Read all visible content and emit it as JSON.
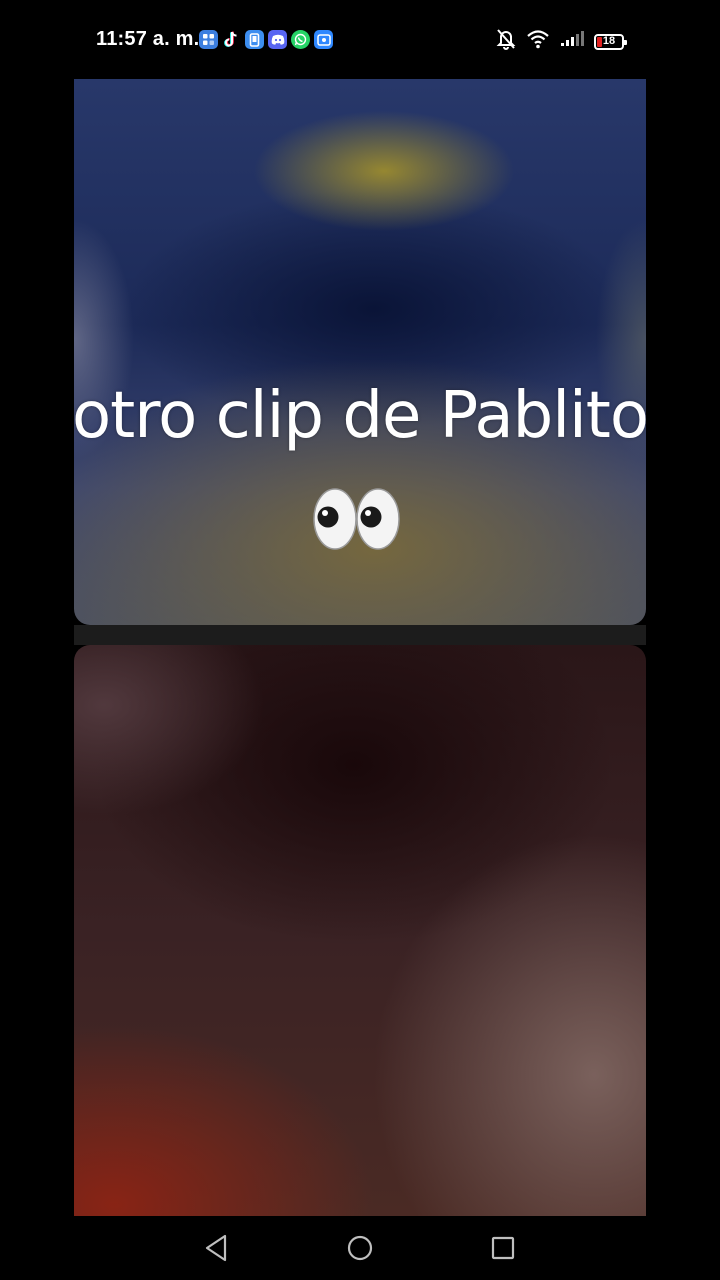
{
  "status_bar": {
    "time": "11:57 a. m.",
    "battery_level": "18",
    "notification_icons": [
      {
        "name": "app-store-icon",
        "color": "#3d7fe0"
      },
      {
        "name": "tiktok-icon",
        "color": "#111111"
      },
      {
        "name": "phone-manager-icon",
        "color": "#3d8ef0"
      },
      {
        "name": "discord-icon",
        "color": "#5865f2"
      },
      {
        "name": "whatsapp-icon",
        "color": "#25d366"
      },
      {
        "name": "screen-recorder-icon",
        "color": "#2f88ff"
      }
    ],
    "system_icons": [
      "bell-off-icon",
      "wifi-icon",
      "signal-icon",
      "battery-icon"
    ]
  },
  "video": {
    "caption": "otro clip de Pablito",
    "caption_emoji": "eyes-emoji",
    "panels": [
      "top-video-panel",
      "bottom-video-panel"
    ]
  },
  "navigation": {
    "buttons": [
      "back",
      "home",
      "recents"
    ]
  }
}
